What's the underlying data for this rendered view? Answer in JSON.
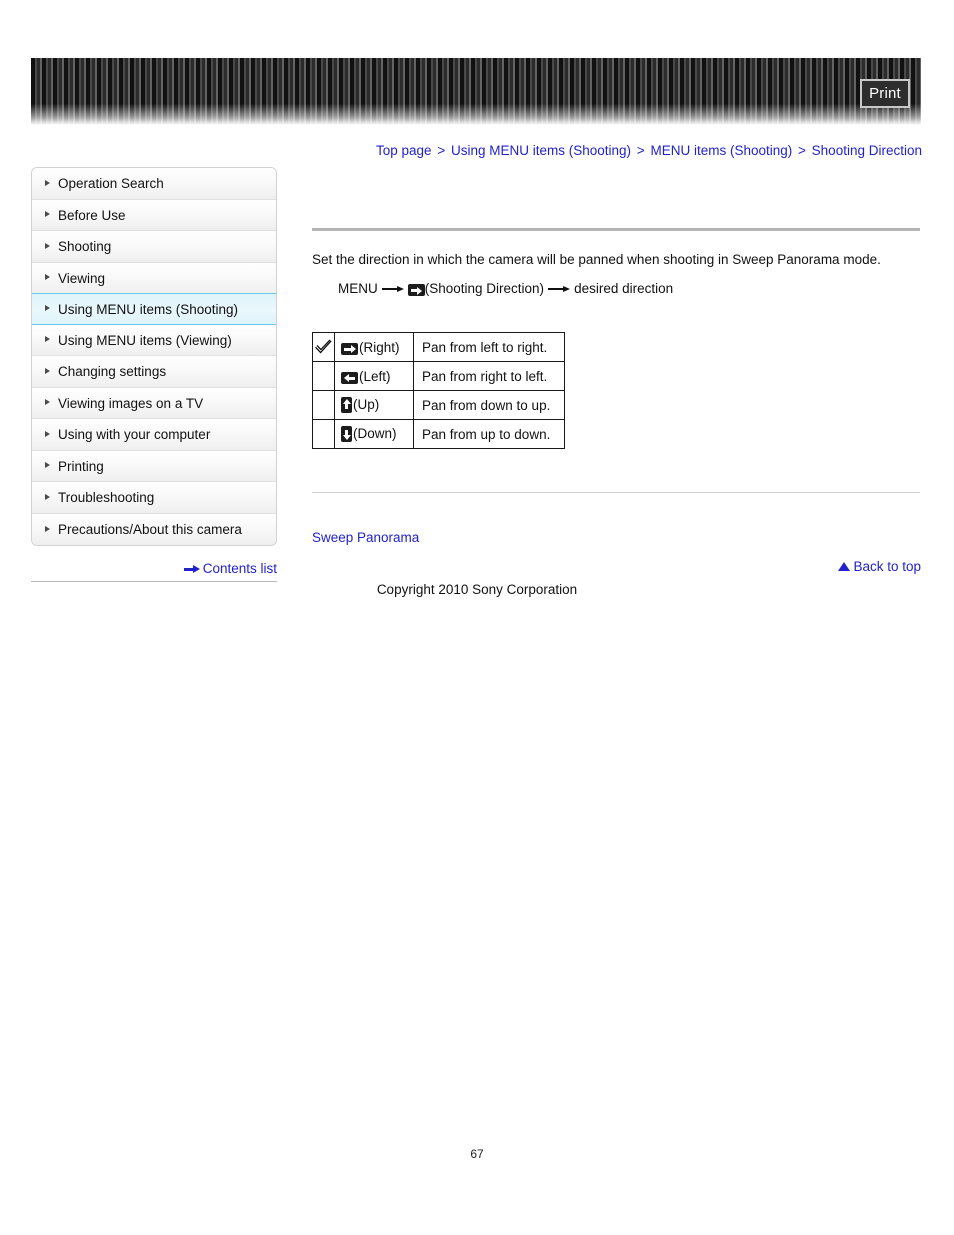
{
  "header": {
    "print_label": "Print",
    "banner_icon": "striped-banner"
  },
  "breadcrumb": {
    "separator": ">",
    "items": [
      {
        "label": "Top page"
      },
      {
        "label": "Using MENU items (Shooting)"
      },
      {
        "label": "MENU items (Shooting)"
      },
      {
        "label": "Shooting Direction"
      }
    ]
  },
  "sidebar": {
    "items": [
      {
        "label": "Operation Search",
        "active": false
      },
      {
        "label": "Before Use",
        "active": false
      },
      {
        "label": "Shooting",
        "active": false
      },
      {
        "label": "Viewing",
        "active": false
      },
      {
        "label": "Using MENU items (Shooting)",
        "active": true
      },
      {
        "label": "Using MENU items (Viewing)",
        "active": false
      },
      {
        "label": "Changing settings",
        "active": false
      },
      {
        "label": "Viewing images on a TV",
        "active": false
      },
      {
        "label": "Using with your computer",
        "active": false
      },
      {
        "label": "Printing",
        "active": false
      },
      {
        "label": "Troubleshooting",
        "active": false
      },
      {
        "label": "Precautions/About this camera",
        "active": false
      }
    ],
    "contents_list_label": "Contents list"
  },
  "main": {
    "description": "Set the direction in which the camera will be panned when shooting in Sweep Panorama mode.",
    "menu_path": {
      "start": "MENU",
      "middle": "(Shooting Direction)",
      "end": "desired direction"
    },
    "table": {
      "rows": [
        {
          "selected": true,
          "icon": "arrow-right-icon",
          "option": "(Right)",
          "description": "Pan from left to right."
        },
        {
          "selected": false,
          "icon": "arrow-left-icon",
          "option": "(Left)",
          "description": "Pan from right to left."
        },
        {
          "selected": false,
          "icon": "arrow-up-icon",
          "option": "(Up)",
          "description": "Pan from down to up."
        },
        {
          "selected": false,
          "icon": "arrow-down-icon",
          "option": "(Down)",
          "description": "Pan from up to down."
        }
      ]
    },
    "related_link": "Sweep Panorama",
    "back_to_top": "Back to top",
    "copyright": "Copyright 2010 Sony Corporation",
    "page_number": "67"
  },
  "colors": {
    "link": "#2222cc",
    "active_nav_border": "#67c9e4",
    "active_nav_bg": "#e1f5fb",
    "banner_dark": "#1c1c1c"
  }
}
